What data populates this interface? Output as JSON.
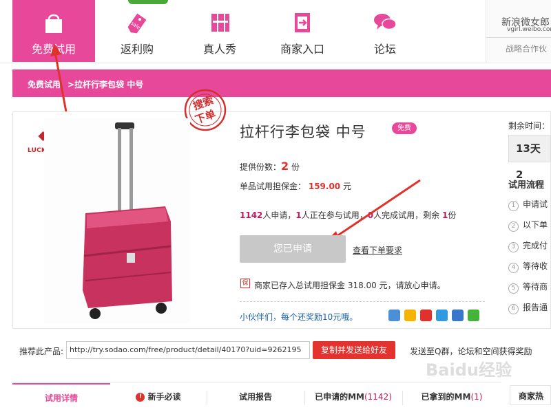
{
  "nav": {
    "items": [
      {
        "label": "免费试用",
        "icon": "shopping-bag-icon"
      },
      {
        "label": "返利购",
        "icon": "sale-tag-icon"
      },
      {
        "label": "真人秀",
        "icon": "people-icon"
      },
      {
        "label": "商家入口",
        "icon": "enter-icon"
      },
      {
        "label": "论坛",
        "icon": "chat-icon"
      }
    ],
    "weibo_title": "新浪微女郎",
    "weibo_url": "vgirl.weibo.com",
    "partner_text": "战略合作伙"
  },
  "breadcrumb": {
    "home": "免费试用",
    "current": ">拉杆行李包袋 中号"
  },
  "stamp": {
    "line1": "搜索",
    "line2": "下单"
  },
  "brand": {
    "name": "LUCKY CLUB"
  },
  "product": {
    "title": "拉杆行李包袋 中号",
    "badge": "免费",
    "supply_label": "提供份数：",
    "supply_count": "2",
    "supply_unit": "份",
    "deposit_label": "单品试用担保金：",
    "deposit_value": "159.00",
    "deposit_unit": "元",
    "stats": {
      "applicants": "1142",
      "applicants_text": "人申请，",
      "trying": "1",
      "trying_text": "人正在参与试用，",
      "completed": "0",
      "completed_text": "人完成试用，剩余 ",
      "remaining": "1",
      "remaining_unit": "份"
    },
    "applied_button": "您已申请",
    "order_link": "查看下单要求",
    "notice": "商家已存入总试用担保金 318.00 元，请放心申请。",
    "partner_text": "小伙伴们，每个还奖励10元哦。"
  },
  "share": {
    "colors": [
      "#4a8fd8",
      "#f5b400",
      "#e0322b",
      "#2f9ae0",
      "#3a76c9",
      "#44b33a"
    ]
  },
  "sidebar": {
    "remaining_label": "剩余时间：",
    "countdown": "13天 2",
    "flow_title": "试用流程",
    "steps": [
      "申请试",
      "以下单",
      "完成付",
      "等待收",
      "等待商",
      "报告通"
    ]
  },
  "recommend": {
    "label": "推荐此产品:",
    "url": "http://try.sodao.com/free/product/detail/40170?uid=9262195",
    "copy_button": "复制并发送给好友",
    "send_text": "发送至Q群，论坛和空间获得奖励"
  },
  "tabs": [
    {
      "label": "试用详情"
    },
    {
      "label": "新手必读"
    },
    {
      "label": "试用报告"
    },
    {
      "label": "已申请的MM",
      "count": "(1142)"
    },
    {
      "label": "已拿到的MM",
      "count": "(1)"
    }
  ],
  "side_tab": "商家热",
  "watermark": "Baidu经验"
}
